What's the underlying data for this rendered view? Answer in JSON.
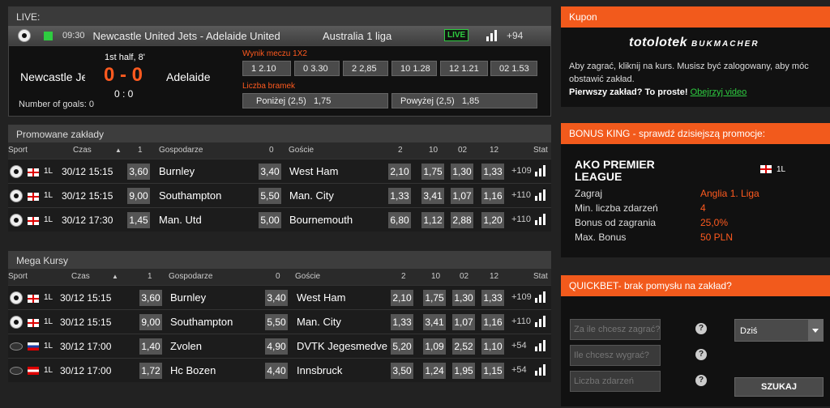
{
  "live": {
    "header": "LIVE:",
    "time": "09:30",
    "match": "Newcastle United Jets  - Adelaide United",
    "league": "Australia 1 liga",
    "badge": "LIVE",
    "more": "+94",
    "home": "Newcastle Jets",
    "away": "Adelaide",
    "half": "1st half, 8'",
    "score": "0 - 0",
    "ht_score": "0 : 0",
    "goals": "Number of goals: 0",
    "wynik_label": "Wynik meczu 1X2",
    "wynik_odds": [
      {
        "name": "1",
        "value": "2.10"
      },
      {
        "name": "0",
        "value": "3.30"
      },
      {
        "name": "2",
        "value": "2,85"
      },
      {
        "name": "10",
        "value": "1.28"
      },
      {
        "name": "12",
        "value": "1.21"
      },
      {
        "name": "02",
        "value": "1.53"
      }
    ],
    "bramki_label": "Liczba bramek",
    "under": {
      "name": "Poniżej (2,5)",
      "value": "1,75"
    },
    "over": {
      "name": "Powyżej (2,5)",
      "value": "1,85"
    }
  },
  "promo": {
    "title": "Promowane zakłady",
    "headers": {
      "sport": "Sport",
      "czas": "Czas",
      "o1": "1",
      "home": "Gospodarze",
      "o0": "0",
      "away": "Goście",
      "o2": "2",
      "o10": "10",
      "o02": "02",
      "o12": "12",
      "stat": "Stat"
    },
    "rows": [
      {
        "lg": "1L",
        "time": "30/12 15:15",
        "o1": "3,60",
        "home": "Burnley",
        "o0": "3,40",
        "away": "West Ham",
        "o2": "2,10",
        "o10": "1,75",
        "o02": "1,30",
        "o12": "1,33",
        "plus": "+109"
      },
      {
        "lg": "1L",
        "time": "30/12 15:15",
        "o1": "9,00",
        "home": "Southampton",
        "o0": "5,50",
        "away": "Man. City",
        "o2": "1,33",
        "o10": "3,41",
        "o02": "1,07",
        "o12": "1,16",
        "plus": "+110"
      },
      {
        "lg": "1L",
        "time": "30/12 17:30",
        "o1": "1,45",
        "home": "Man. Utd",
        "o0": "5,00",
        "away": "Bournemouth",
        "o2": "6,80",
        "o10": "1,12",
        "o02": "2,88",
        "o12": "1,20",
        "plus": "+110"
      }
    ]
  },
  "mega": {
    "title": "Mega Kursy",
    "headers": {
      "sport": "Sport",
      "czas": "Czas",
      "o1": "1",
      "home": "Gospodarze",
      "o0": "0",
      "away": "Goście",
      "o2": "2",
      "o10": "10",
      "o02": "02",
      "o12": "12",
      "stat": "Stat"
    },
    "rows": [
      {
        "lg": "1L",
        "time": "30/12 15:15",
        "o1": "3,60",
        "home": "Burnley",
        "o0": "3,40",
        "away": "West Ham",
        "o2": "2,10",
        "o10": "1,75",
        "o02": "1,30",
        "o12": "1,33",
        "plus": "+109"
      },
      {
        "lg": "1L",
        "time": "30/12 15:15",
        "o1": "9,00",
        "home": "Southampton",
        "o0": "5,50",
        "away": "Man. City",
        "o2": "1,33",
        "o10": "3,41",
        "o02": "1,07",
        "o12": "1,16",
        "plus": "+110"
      },
      {
        "lg": "1L",
        "time": "30/12 17:00",
        "o1": "1,40",
        "home": "Zvolen",
        "o0": "4,90",
        "away": "DVTK Jegesmedvek",
        "o2": "5,20",
        "o10": "1,09",
        "o02": "2,52",
        "o12": "1,10",
        "plus": "+54"
      },
      {
        "lg": "1L",
        "time": "30/12 17:00",
        "o1": "1,72",
        "home": "Hc Bozen",
        "o0": "4,40",
        "away": "Innsbruck",
        "o2": "3,50",
        "o10": "1,24",
        "o02": "1,95",
        "o12": "1,15",
        "plus": "+54"
      }
    ]
  },
  "kupon": {
    "title": "Kupon",
    "logo": "totolotek",
    "logo_sub": "BUKMACHER",
    "text": "Aby zagrać, kliknij na kurs. Musisz być zalogowany, aby móc obstawić zakład.",
    "first_bet": "Pierwszy zakład? To proste!",
    "video_link": "Obejrzyj video"
  },
  "bonus": {
    "title": "BONUS KING - sprawdź dzisiejszą promocje:",
    "league": "AKO PREMIER LEAGUE",
    "flag_label": "1L",
    "items": [
      {
        "label": "Zagraj",
        "value": "Anglia 1. Liga"
      },
      {
        "label": "Min. liczba zdarzeń",
        "value": "4"
      },
      {
        "label": "Bonus od zagrania",
        "value": "25,0%"
      },
      {
        "label": "Max. Bonus",
        "value": "50 PLN"
      }
    ]
  },
  "quickbet": {
    "title": "QUICKBET- brak pomysłu na zakład?",
    "stake_placeholder": "Za ile chcesz zagrać?",
    "win_placeholder": "Ile chcesz wygrać?",
    "events_placeholder": "Liczba zdarzeń",
    "help": "?",
    "period": "Dziś",
    "search": "SZUKAJ"
  },
  "colors": {
    "accent": "#f25a1c",
    "live_green": "#2ecc40"
  }
}
